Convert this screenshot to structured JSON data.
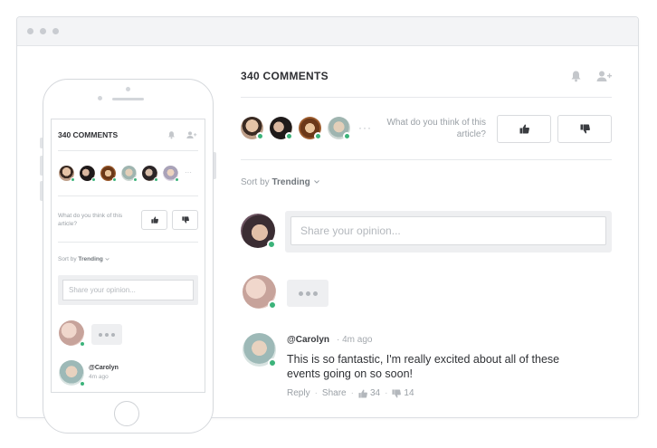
{
  "window": {
    "controls": [
      "close-dot",
      "minimize-dot",
      "maximize-dot"
    ]
  },
  "desktop": {
    "title": "340 COMMENTS",
    "question": "What do you think of this article?",
    "sort_prefix": "Sort by",
    "sort_value": "Trending",
    "more_label": "···",
    "input_placeholder": "Share your opinion...",
    "comment": {
      "author": "@Carolyn",
      "time": "4m ago",
      "text": "This is so fantastic, I'm really excited about all of these events going on so soon!",
      "reply_label": "Reply",
      "share_label": "Share",
      "likes": "34",
      "dislikes": "14"
    }
  },
  "mobile": {
    "title": "340 COMMENTS",
    "question": "What do you think of this article?",
    "sort_prefix": "Sort by",
    "sort_value": "Trending",
    "more_label": "···",
    "input_placeholder": "Share your opinion...",
    "comment": {
      "author": "@Carolyn",
      "time": "4m ago"
    }
  },
  "colors": {
    "online": "#3cb37a",
    "border": "#d9dbde",
    "muted_text": "#9aa0a6",
    "title_text": "#2e2f33",
    "panel_bg": "#eeeff1"
  },
  "icons": [
    "bell-icon",
    "add-user-icon",
    "thumbs-up-icon",
    "thumbs-down-icon",
    "chevron-down-icon"
  ]
}
